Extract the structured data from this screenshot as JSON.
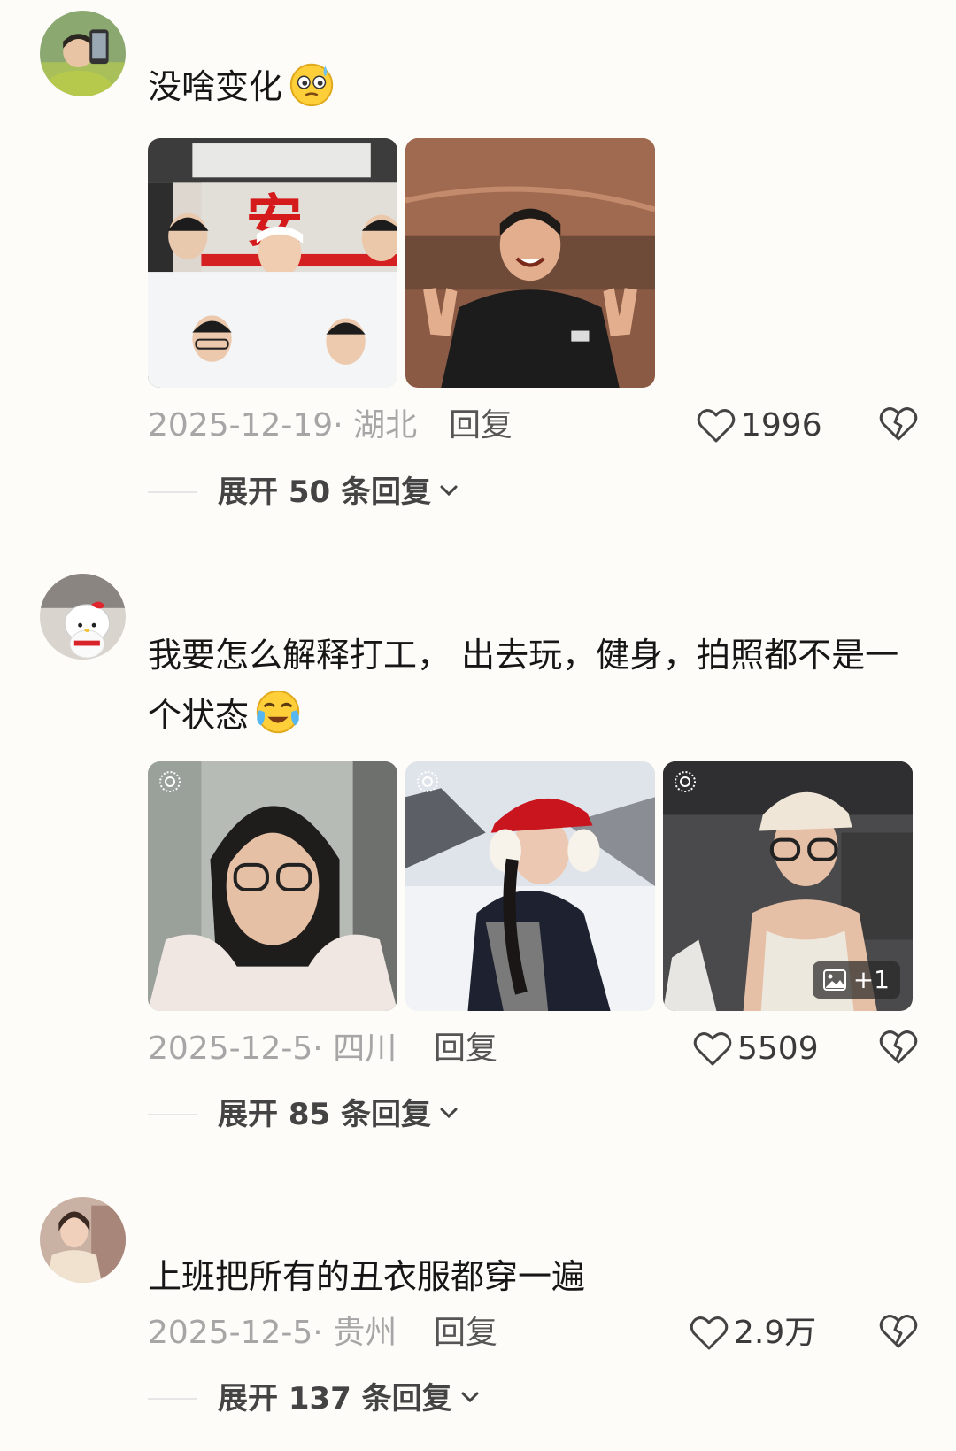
{
  "comments": [
    {
      "text": "没啥变化",
      "emoji": "sweating-smile-emoji",
      "photos": [
        "group-nurses-photo",
        "woman-peace-sign-photo"
      ],
      "date_location": "2025-12-19· 湖北",
      "reply_label": "回复",
      "likes": "1996",
      "expand_label": "展开 50 条回复"
    },
    {
      "text": "我要怎么解释打工， 出去玩，健身，拍照都不是一个状态",
      "emoji": "crying-laugh-emoji",
      "photos": [
        "commute-selfie-photo",
        "snow-selfie-photo",
        "gym-selfie-photo"
      ],
      "extra_photos_label": "+1",
      "date_location": "2025-12-5· 四川",
      "reply_label": "回复",
      "likes": "5509",
      "expand_label": "展开 85 条回复"
    },
    {
      "text": "上班把所有的丑衣服都穿一遍",
      "date_location": "2025-12-5· 贵州",
      "reply_label": "回复",
      "likes": "2.9万",
      "expand_label": "展开 137 条回复"
    }
  ],
  "colors": {
    "background": "#fdfcf8",
    "meta_gray": "#a6a6a6",
    "text": "#161616"
  }
}
